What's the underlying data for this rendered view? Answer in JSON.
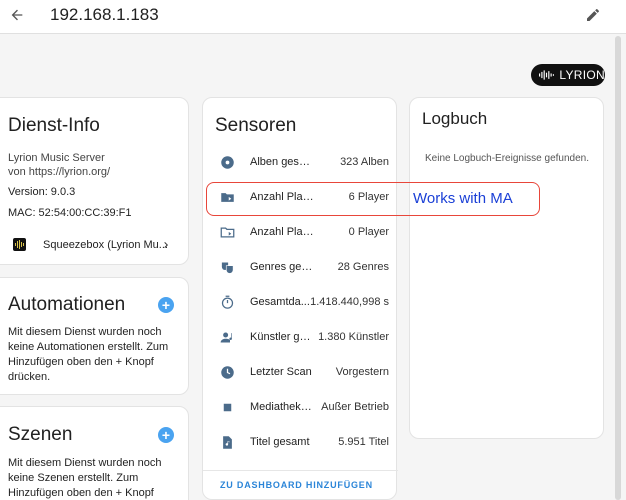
{
  "topbar": {
    "title": "192.168.1.183",
    "back_icon": "arrow-left-icon",
    "edit_icon": "pencil-icon"
  },
  "brand_badge": {
    "label": "LYRION"
  },
  "service_info": {
    "title": "Dienst-Info",
    "line1": "Lyrion Music Server",
    "line2": "von https://lyrion.org/",
    "version": "Version: 9.0.3",
    "mac": "MAC: 52:54:00:CC:39:F1",
    "device": "Squeezebox (Lyrion Mu..."
  },
  "automations": {
    "title": "Automationen",
    "text": "Mit diesem Dienst wurden noch keine Automationen erstellt. Zum Hinzufügen oben den + Knopf drücken."
  },
  "scenes": {
    "title": "Szenen",
    "text": "Mit diesem Dienst wurden noch keine Szenen erstellt. Zum Hinzufügen oben den + Knopf drücken."
  },
  "sensors": {
    "title": "Sensoren",
    "items": [
      {
        "label": "Alben gesamt",
        "value": "323 Alben",
        "icon": "disc-icon"
      },
      {
        "label": "Anzahl Player",
        "value": "6 Player",
        "icon": "folder-play-icon"
      },
      {
        "label": "Anzahl Player auß...",
        "value": "0 Player",
        "icon": "folder-outline-icon"
      },
      {
        "label": "Genres gesamt",
        "value": "28 Genres",
        "icon": "drama-masks-icon"
      },
      {
        "label": "Gesamtda...",
        "value": "1.418.440,998 s",
        "icon": "timer-icon"
      },
      {
        "label": "Künstler ge...",
        "value": "1.380 Künstler",
        "icon": "account-music-icon"
      },
      {
        "label": "Letzter Scan",
        "value": "Vorgestern",
        "icon": "clock-icon"
      },
      {
        "label": "Mediathek n...",
        "value": "Außer Betrieb",
        "icon": "stop-square-icon"
      },
      {
        "label": "Titel gesamt",
        "value": "5.951 Titel",
        "icon": "file-music-icon"
      }
    ],
    "add_to_dashboard": "ZU DASHBOARD HINZUFÜGEN"
  },
  "logbook": {
    "title": "Logbuch",
    "empty_text": "Keine Logbuch-Ereignisse gefunden."
  },
  "annotation": {
    "text": "Works with MA",
    "color": "#e8463a"
  },
  "colors": {
    "accent": "#4aa3f0",
    "icon": "#4b6b8a"
  }
}
